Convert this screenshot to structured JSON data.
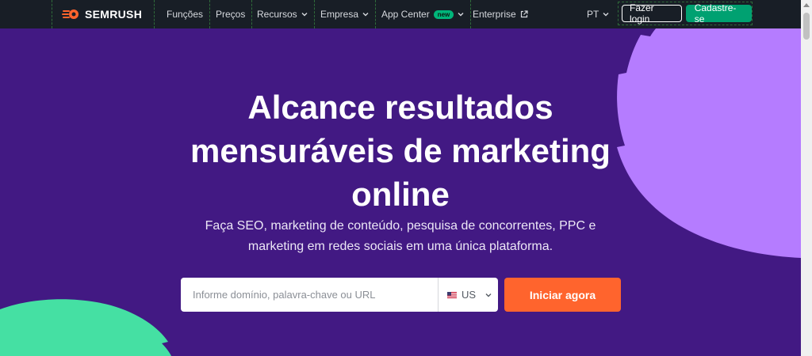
{
  "brand": {
    "name": "SEMRUSH"
  },
  "nav": {
    "items": [
      {
        "label": "Funções"
      },
      {
        "label": "Preços"
      },
      {
        "label": "Recursos"
      },
      {
        "label": "Empresa"
      },
      {
        "label": "App Center",
        "badge": "new"
      },
      {
        "label": "Enterprise"
      }
    ],
    "language": "PT",
    "login_label": "Fazer login",
    "signup_label": "Cadastre-se"
  },
  "hero": {
    "title_line1": "Alcance resultados",
    "title_line2": "mensuráveis de marketing",
    "title_line3": "online",
    "subtitle_line1": "Faça SEO, marketing de conteúdo, pesquisa de concorrentes, PPC e",
    "subtitle_line2": "marketing em redes sociais em uma única plataforma."
  },
  "search": {
    "placeholder": "Informe domínio, palavra-chave ou URL",
    "value": "",
    "country": "US",
    "button_label": "Iniciar agora"
  },
  "colors": {
    "background": "#421983",
    "topbar": "#181e26",
    "accent_orange": "#ff642d",
    "accent_green": "#00a171",
    "shape_lavender": "#b57cff",
    "shape_mint": "#45e0a3"
  },
  "icons": [
    "semrush-logo-icon",
    "chevron-down-icon",
    "external-link-icon",
    "us-flag-icon"
  ]
}
